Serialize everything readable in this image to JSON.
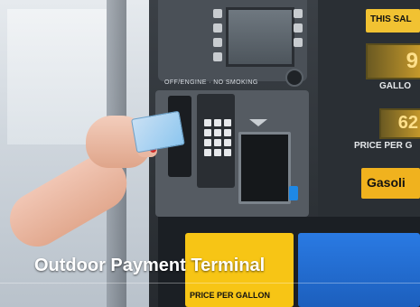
{
  "photo": {
    "caption": "Outdoor Payment Terminal",
    "pump": {
      "warning_text": "OFF/ENGINE · NO SMOKING",
      "sign_text": "THIS SAL",
      "price_digits_top": "9",
      "gallons_label": "GALLO",
      "price_digits_mid": "62",
      "price_per_label": "PRICE PER G",
      "grade_label": "Gasoli",
      "lower_label": "PRICE PER GALLON"
    },
    "colors": {
      "card_blue": "#8cc6ef",
      "sign_yellow": "#f0b21e",
      "pump_blue": "#1c5fbd"
    }
  }
}
